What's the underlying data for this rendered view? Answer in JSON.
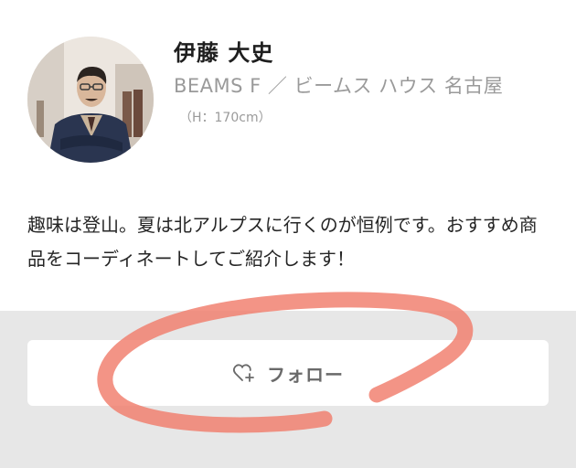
{
  "profile": {
    "name": "伊藤 大史",
    "shop": "BEAMS F ／ ビームス ハウス 名古屋",
    "height": "（H：170cm）",
    "bio": "趣味は登山。夏は北アルプスに行くのが恒例です。おすすめ商品をコーディネートしてご紹介します！"
  },
  "follow": {
    "label": "フォロー",
    "icon": "heart-plus-icon"
  },
  "colors": {
    "annotation": "#f07d6b",
    "footer_bg": "#e7e7e7",
    "muted_text": "#9a9a9a"
  }
}
